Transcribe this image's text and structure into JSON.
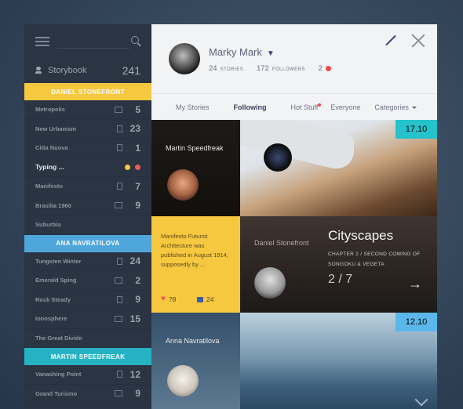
{
  "sidebar": {
    "storybook": {
      "label": "Storybook",
      "count": "241"
    },
    "groups": [
      {
        "name": "DANIEL STONEFRONT",
        "color": "#f6c83f",
        "items": [
          {
            "label": "Metropolis",
            "icon": "image-icon",
            "count": "5"
          },
          {
            "label": "New Urbanism",
            "icon": "document-icon",
            "count": "23"
          },
          {
            "label": "Citta Nuova",
            "icon": "document-icon",
            "count": "1"
          },
          {
            "label": "Typing ...",
            "typing": true
          },
          {
            "label": "Manifesto",
            "icon": "document-icon",
            "count": "7"
          },
          {
            "label": "Brasilia 1960",
            "icon": "image-icon",
            "count": "9"
          },
          {
            "label": "Suburbia"
          }
        ]
      },
      {
        "name": "ANA NAVRATILOVA",
        "color": "#4fa6db",
        "items": [
          {
            "label": "Tungsten Winter",
            "icon": "document-icon",
            "count": "24"
          },
          {
            "label": "Emerald Sping",
            "icon": "image-icon",
            "count": "2"
          },
          {
            "label": "Rock Steady",
            "icon": "document-icon",
            "count": "9"
          },
          {
            "label": "Ionosphere",
            "icon": "image-icon",
            "count": "15"
          },
          {
            "label": "The Great Divide"
          }
        ]
      },
      {
        "name": "MARTIN SPEEDFREAK",
        "color": "#25b3c3",
        "items": [
          {
            "label": "Vanashing Point",
            "icon": "document-icon",
            "count": "12"
          },
          {
            "label": "Grand Turismo",
            "icon": "image-icon",
            "count": "9"
          }
        ]
      }
    ]
  },
  "profile": {
    "name": "Marky Mark",
    "stories": "24",
    "stories_label": "STORIES",
    "followers": "172",
    "followers_label": "FOLLOWERS",
    "messages": "2"
  },
  "tabs": [
    "My Stories",
    "Following",
    "Hot Stuff",
    "Everyone",
    "Categories"
  ],
  "active_tab": "Following",
  "feed": [
    {
      "author": "Martin Speedfreak",
      "date": "17.10",
      "date_color": "#25c2cc"
    },
    {
      "author": "Daniel Stonefront",
      "snippet": "Manifesto Futurist Architecture was published in August 1914, supposedly by ...",
      "likes": "78",
      "comments": "24",
      "title": "Cityscapes",
      "chapter": "CHAPTER 2 / SECOND COMING OF SONGOKU & VEGETA",
      "page": "2 / 7"
    },
    {
      "author": "Anna Navratilova",
      "date": "12.10",
      "date_color": "#5bb7ea"
    }
  ]
}
